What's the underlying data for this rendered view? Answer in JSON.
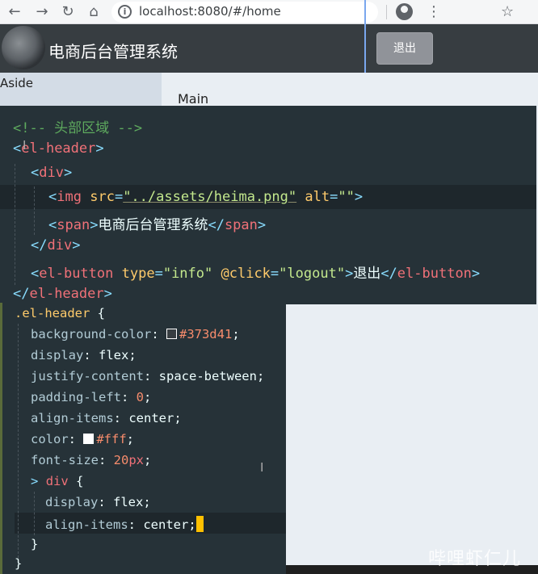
{
  "browser": {
    "back_icon": "←",
    "forward_icon": "→",
    "reload_icon": "↻",
    "home_icon": "⌂",
    "url": "localhost:8080/#/home",
    "star_icon": "☆",
    "menu_icon": "⋮"
  },
  "app_header": {
    "title": "电商后台管理系统",
    "logout_label": "退出"
  },
  "layout_labels": {
    "aside": "Aside",
    "main": "Main"
  },
  "template_code": {
    "line1_comment": "<!-- 头部区域 -->",
    "l2_open": "<",
    "l2_tag": "el-header",
    "l2_close": ">",
    "l3_open": "<",
    "l3_tag": "div",
    "l3_close": ">",
    "l4_open": "<",
    "l4_tag": "img",
    "l4_attr1": "src",
    "l4_eq1": "=",
    "l4_val1": "\"../assets/heima.png\"",
    "l4_attr2": "alt",
    "l4_eq2": "=",
    "l4_val2": "\"\"",
    "l4_close": ">",
    "l5_open": "<",
    "l5_tag": "span",
    "l5_close": ">",
    "l5_text": "电商后台管理系统",
    "l5_end_open": "</",
    "l5_end_tag": "span",
    "l5_end_close": ">",
    "l6_open": "</",
    "l6_tag": "div",
    "l6_close": ">",
    "l7_open": "<",
    "l7_tag": "el-button",
    "l7_attr1": "type",
    "l7_eq1": "=",
    "l7_val1": "\"info\"",
    "l7_attr2": "@click",
    "l7_eq2": "=",
    "l7_val2": "\"logout\"",
    "l7_close": ">",
    "l7_text": "退出",
    "l7_end_open": "</",
    "l7_end_tag": "el-button",
    "l7_end_close": ">",
    "l8_open": "</",
    "l8_tag": "el-header",
    "l8_close": ">"
  },
  "style_code": {
    "selector": ".el-header",
    "brace_open": " {",
    "p1": "background-color",
    "p1_val": "#373d41",
    "p2": "display",
    "p2_val": "flex",
    "p3": "justify-content",
    "p3_val": "space-between",
    "p4": "padding-left",
    "p4_val": "0",
    "p5": "align-items",
    "p5_val": "center",
    "p6": "color",
    "p6_val": "#fff",
    "p7": "font-size",
    "p7_num": "20",
    "p7_unit": "px",
    "nested_marker": ">",
    "nested_selector": "div",
    "nested_brace": " {",
    "n1": "display",
    "n1_val": "flex",
    "n2": "align-items",
    "n2_val": "center",
    "inner_close": "}",
    "outer_close": "}",
    "colon": ": ",
    "semicolon": ";"
  },
  "colors": {
    "header_bg": "#373d41",
    "editor_bg": "#263238",
    "cursor": "#ffc000"
  },
  "watermark": "哔哩虾仁儿"
}
